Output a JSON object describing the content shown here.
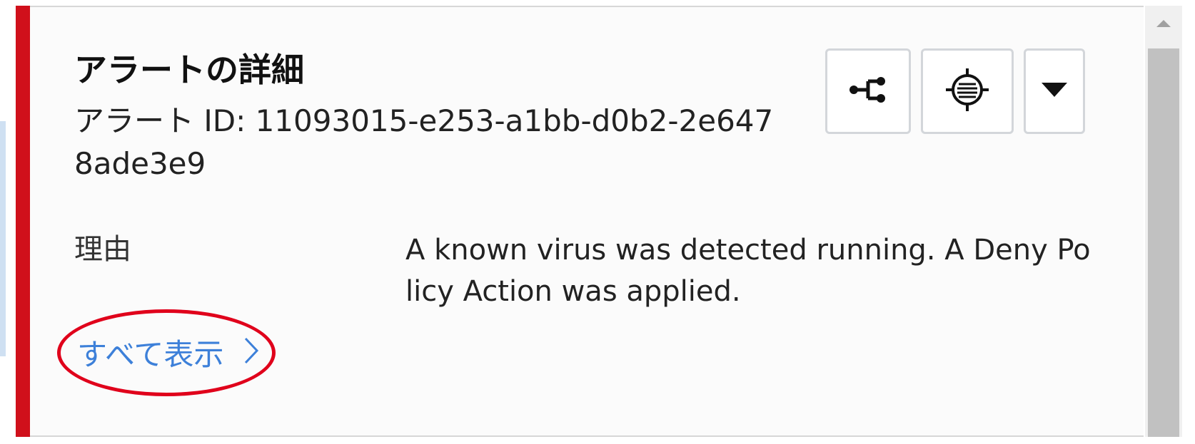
{
  "alert": {
    "title": "アラートの詳細",
    "id_line": "アラート ID: 11093015-e253-a1bb-d0b2-2e6478ade3e9",
    "severity_color": "#d0101b"
  },
  "details": {
    "reason_label": "理由",
    "reason_value": "A known virus was detected running. A Deny Policy Action was applied."
  },
  "actions": {
    "show_all_label": "すべて表示",
    "show_all_color": "#3d80d9"
  },
  "toolbar": {
    "buttons": [
      {
        "icon": "process-flow-icon"
      },
      {
        "icon": "target-icon"
      },
      {
        "icon": "caret-down-icon"
      }
    ]
  },
  "annotation": {
    "color": "#e0001b"
  }
}
